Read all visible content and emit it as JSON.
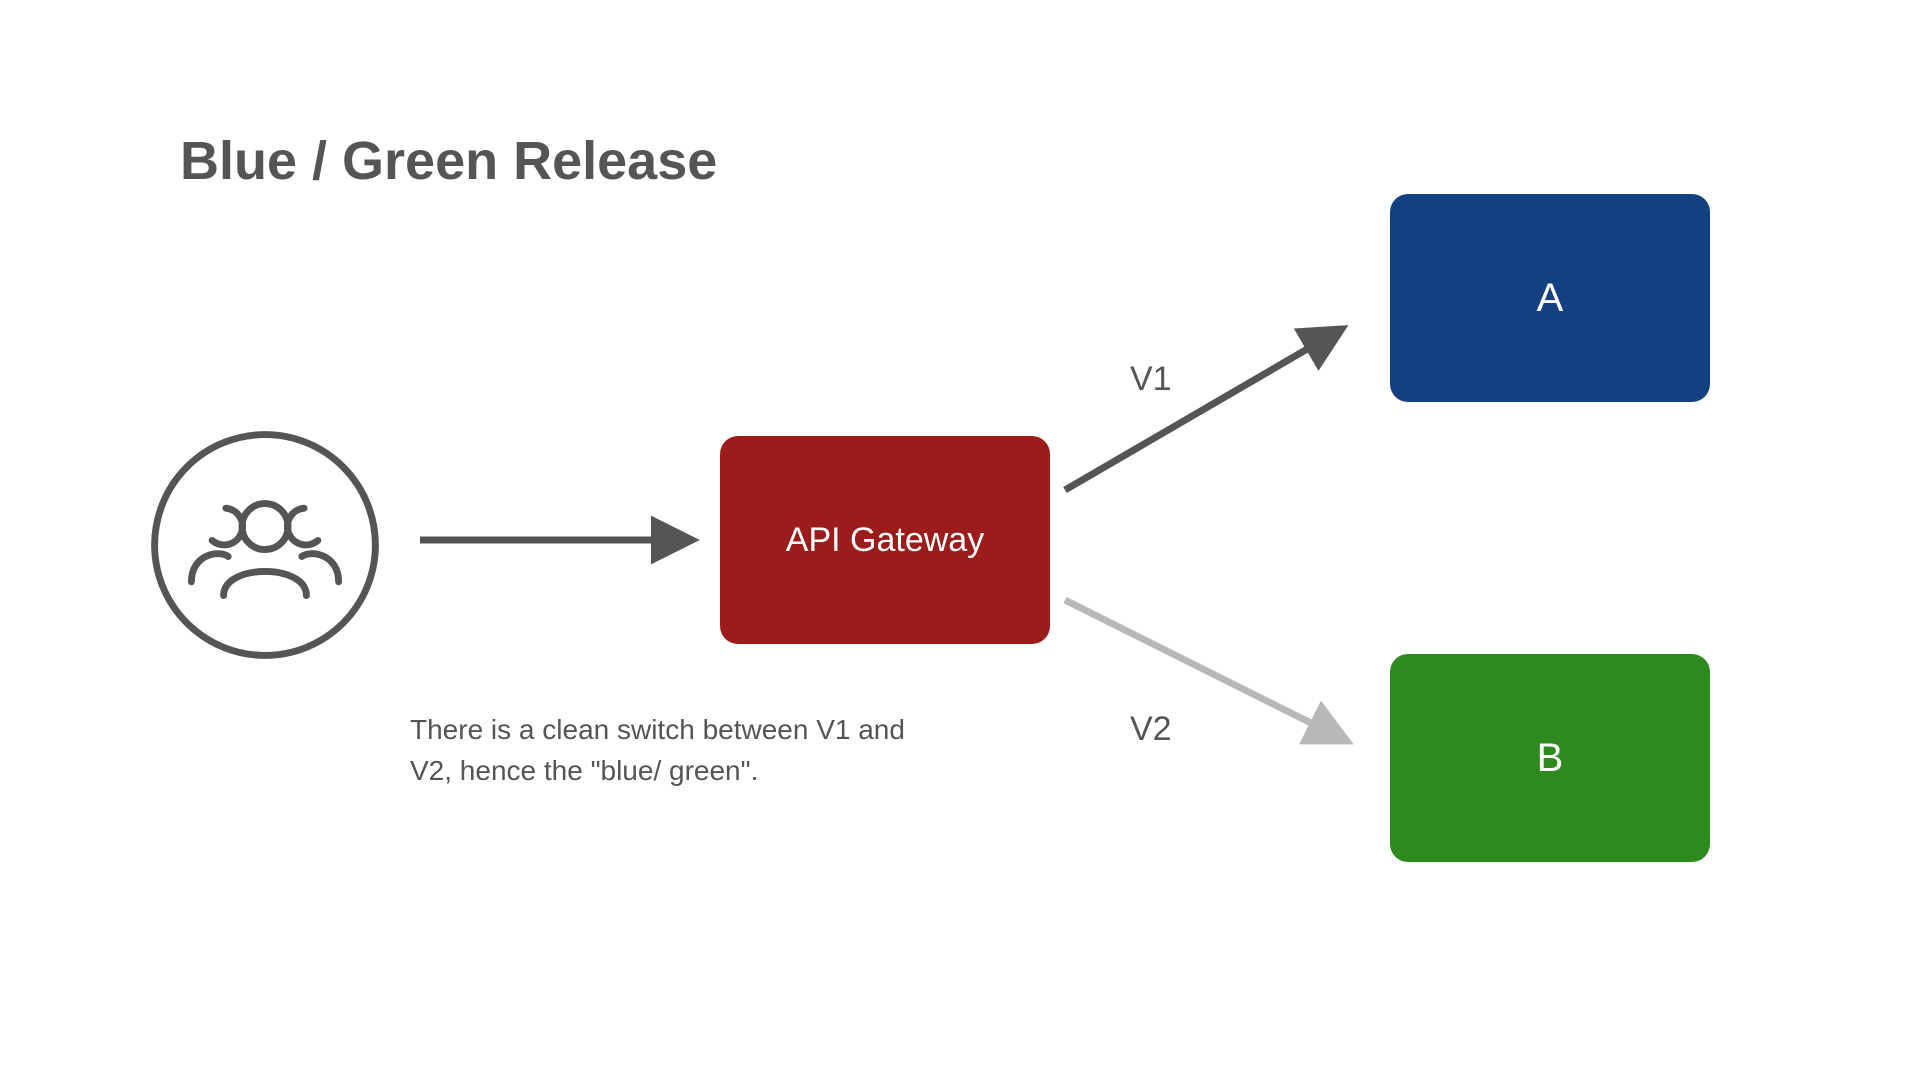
{
  "title": "Blue / Green Release",
  "caption": "There is a clean switch between V1 and V2, hence the \"blue/ green\".",
  "gateway_label": "API Gateway",
  "box_a_label": "A",
  "box_b_label": "B",
  "v1_label": "V1",
  "v2_label": "V2",
  "colors": {
    "gateway": "#9c1c1c",
    "box_a": "#134080",
    "box_b": "#2f8a1e",
    "arrow_dark": "#555555",
    "arrow_light": "#b8b8b8",
    "text": "#555555"
  },
  "icons": {
    "users": "users-icon"
  }
}
